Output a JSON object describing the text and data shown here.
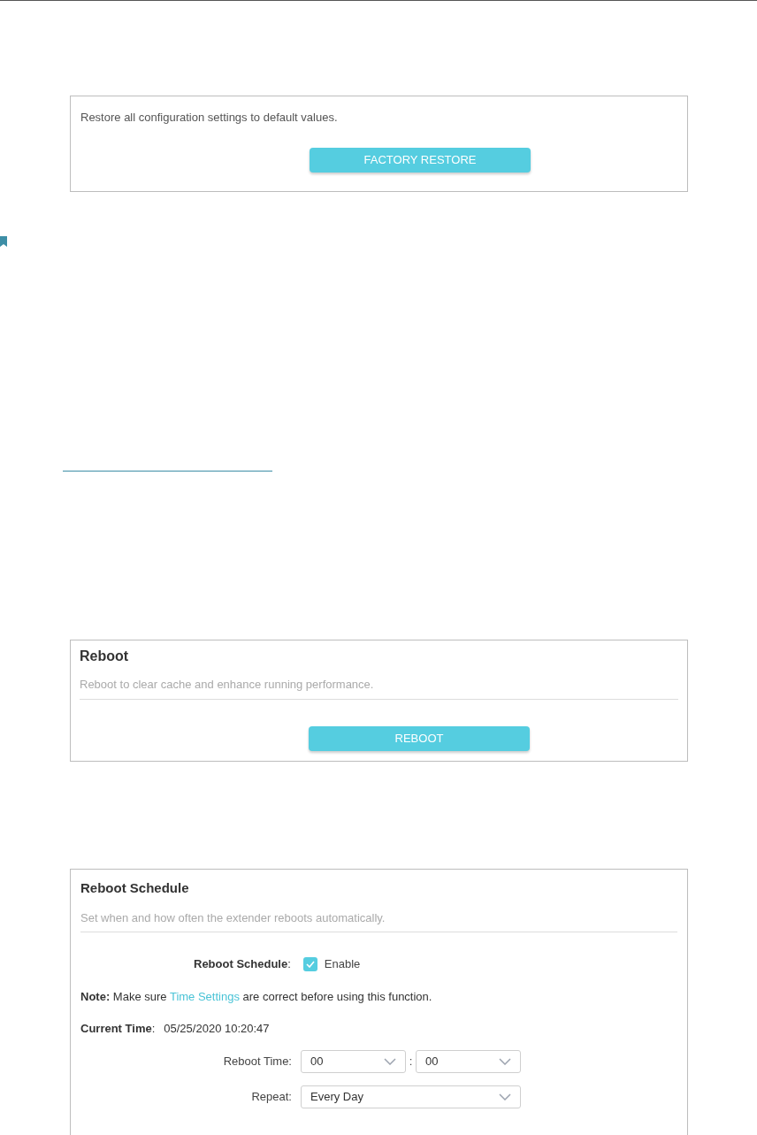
{
  "restore_panel": {
    "description": "Restore all configuration settings to default values.",
    "button": "FACTORY RESTORE"
  },
  "reboot_panel": {
    "title": "Reboot",
    "description": "Reboot to clear cache and enhance running performance.",
    "button": "REBOOT"
  },
  "schedule_panel": {
    "title": "Reboot Schedule",
    "description": "Set when and how often the extender reboots automatically.",
    "schedule_label": "Reboot Schedule",
    "schedule_colon": ":",
    "enable": {
      "label": "Enable",
      "checked": true
    },
    "note": "**Note:** Make sure",
    "note_link": "Time Settings",
    "note_tail": "are correct before using this function.",
    "current_time_label": "Current Time",
    "current_time_colon": ":",
    "current_time": "05/25/2020 10:20:47",
    "reboot_time_label": "Reboot Time:",
    "hour": "00",
    "separator": ":",
    "minute": "00",
    "repeat_label": "Repeat:",
    "repeat": "Every Day"
  }
}
